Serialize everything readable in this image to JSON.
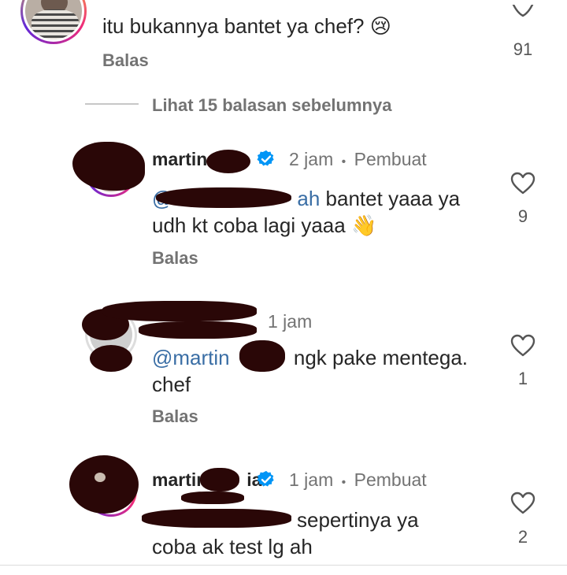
{
  "top_comment": {
    "text": "itu bukannya bantet ya chef? 😢",
    "reply_label": "Balas",
    "likes": "91"
  },
  "view_replies_label": "Lihat 15 balasan sebelumnya",
  "replies": [
    {
      "username": "martin",
      "verified": true,
      "time": "2 jam",
      "separator": "•",
      "badge": "Pembuat",
      "mention": "@",
      "mention_tail": "ah",
      "text_line1": " bantet yaaa ya",
      "text_line2": "udh kt coba lagi yaaa 👋",
      "reply_label": "Balas",
      "likes": "9"
    },
    {
      "username": "",
      "time": "1 jam",
      "mention": "@martin",
      "text_line1": " ngk pake mentega.",
      "text_line2": "chef",
      "reply_label": "Balas",
      "likes": "1"
    },
    {
      "username": "martin",
      "username_tail": "ia",
      "verified": true,
      "time": "1 jam",
      "separator": "•",
      "badge": "Pembuat",
      "text_line1": "sepertinya ya",
      "text_line2": "coba ak test lg ah",
      "likes": "2"
    }
  ],
  "colors": {
    "text": "#262626",
    "secondary": "#737373",
    "link": "#3a6ea5",
    "verified": "#0095f6",
    "redaction": "#2a0707"
  }
}
